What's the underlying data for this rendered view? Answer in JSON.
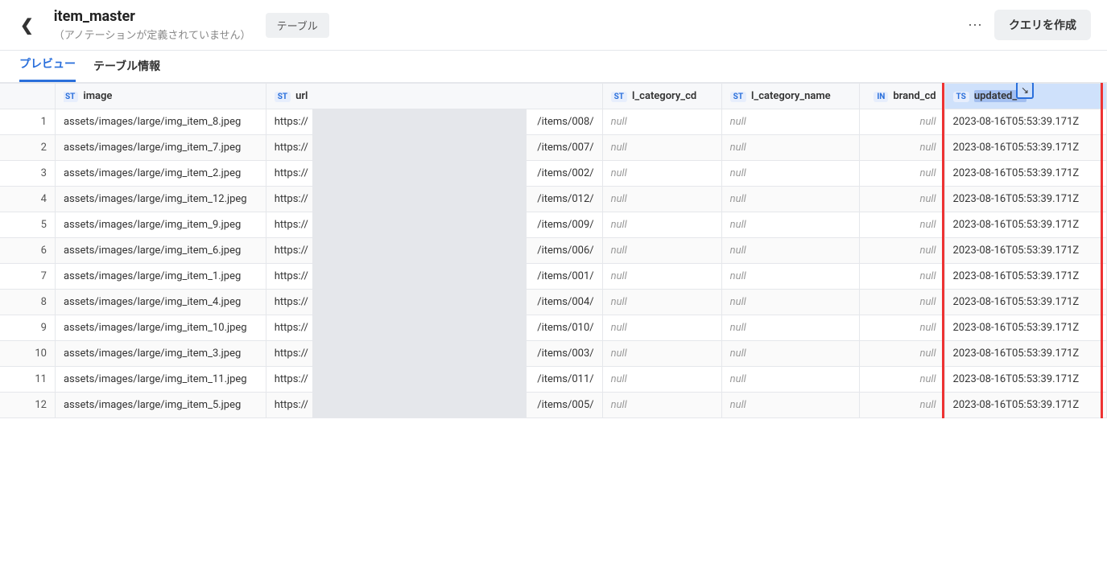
{
  "header": {
    "title": "item_master",
    "subtitle": "（アノテーションが定義されていません）",
    "badge": "テーブル",
    "dots": "⋯",
    "query_button": "クエリを作成"
  },
  "tabs": [
    {
      "label": "プレビュー",
      "active": true
    },
    {
      "label": "テーブル情報",
      "active": false
    }
  ],
  "columns": [
    {
      "type": "ST",
      "name": "image",
      "type_partial": true
    },
    {
      "type": "ST",
      "name": "url"
    },
    {
      "type": "ST",
      "name": "l_category_cd"
    },
    {
      "type": "ST",
      "name": "l_category_name"
    },
    {
      "type": "IN",
      "name": "brand_cd"
    },
    {
      "type": "TS",
      "name": "updated_at",
      "highlighted": true
    }
  ],
  "rows": [
    {
      "n": 1,
      "image": "assets/images/large/img_item_8.jpeg",
      "url_prefix": "https://",
      "url_suffix": "/items/008/",
      "lcat": null,
      "lcatname": null,
      "brand": null,
      "updated": "2023-08-16T05:53:39.171Z"
    },
    {
      "n": 2,
      "image": "assets/images/large/img_item_7.jpeg",
      "url_prefix": "https://",
      "url_suffix": "/items/007/",
      "lcat": null,
      "lcatname": null,
      "brand": null,
      "updated": "2023-08-16T05:53:39.171Z"
    },
    {
      "n": 3,
      "image": "assets/images/large/img_item_2.jpeg",
      "url_prefix": "https://",
      "url_suffix": "/items/002/",
      "lcat": null,
      "lcatname": null,
      "brand": null,
      "updated": "2023-08-16T05:53:39.171Z"
    },
    {
      "n": 4,
      "image": "assets/images/large/img_item_12.jpeg",
      "url_prefix": "https://",
      "url_suffix": "/items/012/",
      "lcat": null,
      "lcatname": null,
      "brand": null,
      "updated": "2023-08-16T05:53:39.171Z"
    },
    {
      "n": 5,
      "image": "assets/images/large/img_item_9.jpeg",
      "url_prefix": "https://",
      "url_suffix": "/items/009/",
      "lcat": null,
      "lcatname": null,
      "brand": null,
      "updated": "2023-08-16T05:53:39.171Z"
    },
    {
      "n": 6,
      "image": "assets/images/large/img_item_6.jpeg",
      "url_prefix": "https://",
      "url_suffix": "/items/006/",
      "lcat": null,
      "lcatname": null,
      "brand": null,
      "updated": "2023-08-16T05:53:39.171Z"
    },
    {
      "n": 7,
      "image": "assets/images/large/img_item_1.jpeg",
      "url_prefix": "https://",
      "url_suffix": "/items/001/",
      "lcat": null,
      "lcatname": null,
      "brand": null,
      "updated": "2023-08-16T05:53:39.171Z"
    },
    {
      "n": 8,
      "image": "assets/images/large/img_item_4.jpeg",
      "url_prefix": "https://",
      "url_suffix": "/items/004/",
      "lcat": null,
      "lcatname": null,
      "brand": null,
      "updated": "2023-08-16T05:53:39.171Z"
    },
    {
      "n": 9,
      "image": "assets/images/large/img_item_10.jpeg",
      "url_prefix": "https://",
      "url_suffix": "/items/010/",
      "lcat": null,
      "lcatname": null,
      "brand": null,
      "updated": "2023-08-16T05:53:39.171Z"
    },
    {
      "n": 10,
      "image": "assets/images/large/img_item_3.jpeg",
      "url_prefix": "https://",
      "url_suffix": "/items/003/",
      "lcat": null,
      "lcatname": null,
      "brand": null,
      "updated": "2023-08-16T05:53:39.171Z"
    },
    {
      "n": 11,
      "image": "assets/images/large/img_item_11.jpeg",
      "url_prefix": "https://",
      "url_suffix": "/items/011/",
      "lcat": null,
      "lcatname": null,
      "brand": null,
      "updated": "2023-08-16T05:53:39.171Z"
    },
    {
      "n": 12,
      "image": "assets/images/large/img_item_5.jpeg",
      "url_prefix": "https://",
      "url_suffix": "/items/005/",
      "lcat": null,
      "lcatname": null,
      "brand": null,
      "updated": "2023-08-16T05:53:39.171Z"
    }
  ],
  "null_text": "null"
}
